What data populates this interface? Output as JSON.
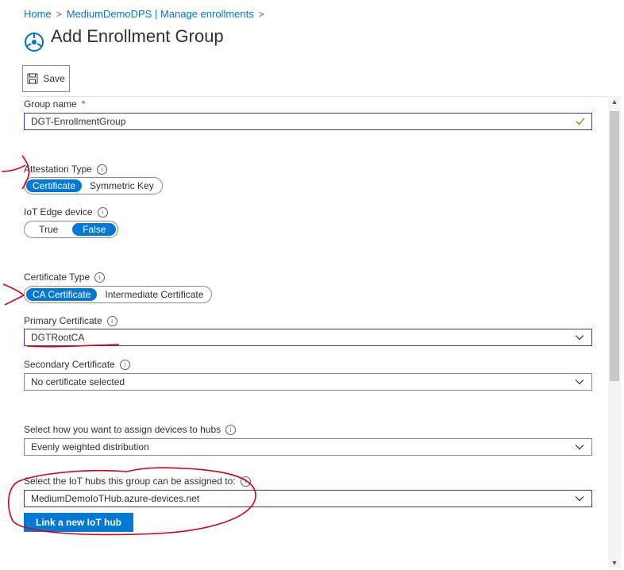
{
  "breadcrumb": {
    "home": "Home",
    "parent": "MediumDemoDPS | Manage enrollments"
  },
  "page_title": "Add Enrollment Group",
  "toolbar": {
    "save_label": "Save"
  },
  "form": {
    "group_name": {
      "label": "Group name",
      "required_mark": "*",
      "value": "DGT-EnrollmentGroup"
    },
    "attestation_type": {
      "label": "Attestation Type",
      "options": [
        "Certificate",
        "Symmetric Key"
      ],
      "selected": "Certificate"
    },
    "iot_edge_device": {
      "label": "IoT Edge device",
      "options": [
        "True",
        "False"
      ],
      "selected": "False"
    },
    "certificate_type": {
      "label": "Certificate Type",
      "options": [
        "CA Certificate",
        "Intermediate Certificate"
      ],
      "selected": "CA Certificate"
    },
    "primary_certificate": {
      "label": "Primary Certificate",
      "value": "DGTRootCA"
    },
    "secondary_certificate": {
      "label": "Secondary Certificate",
      "value": "No certificate selected"
    },
    "assign_policy": {
      "label": "Select how you want to assign devices to hubs",
      "value": "Evenly weighted distribution"
    },
    "iot_hubs": {
      "label": "Select the IoT hubs this group can be assigned to:",
      "value": "MediumDemoIoTHub.azure-devices.net"
    },
    "link_hub_button": "Link a new IoT hub"
  },
  "colors": {
    "accent": "#0078d4",
    "annotation": "#d0021b",
    "field_border_active": "#5c2d91"
  },
  "icons": [
    "dps-service-icon",
    "save-icon",
    "info-icon",
    "check-icon",
    "chevron-down-icon"
  ]
}
